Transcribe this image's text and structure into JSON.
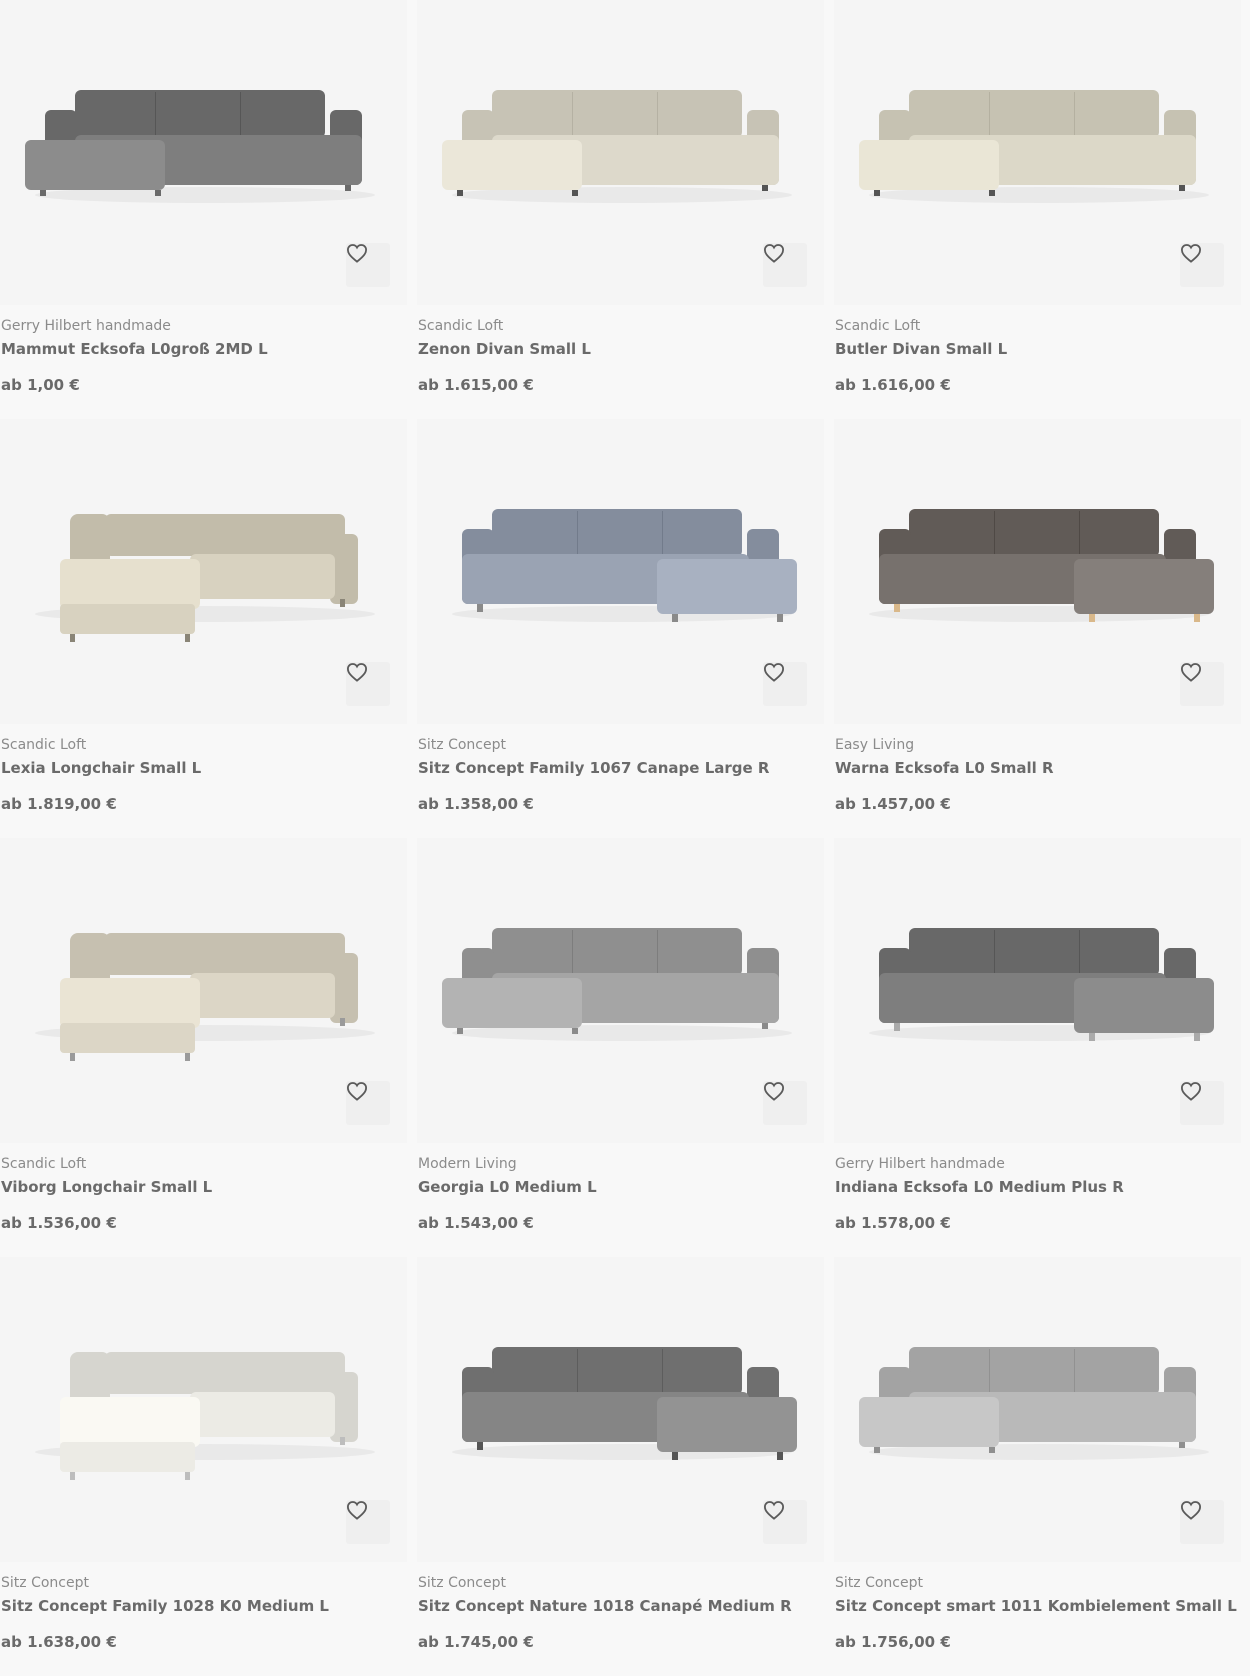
{
  "products": [
    {
      "brand": "Gerry Hilbert handmade",
      "name": "Mammut Ecksofa L0groß 2MD L",
      "price": "ab 1,00 €",
      "color": "#7e7e7e",
      "legs": "#6a6a6a",
      "shape": "chaise-left"
    },
    {
      "brand": "Scandic Loft",
      "name": "Zenon Divan Small L",
      "price": "ab 1.615,00 €",
      "color": "#ddd9cb",
      "legs": "#555555",
      "shape": "chaise-left"
    },
    {
      "brand": "Scandic Loft",
      "name": "Butler Divan Small L",
      "price": "ab 1.616,00 €",
      "color": "#dcd8c8",
      "legs": "#555555",
      "shape": "chaise-left"
    },
    {
      "brand": "Scandic Loft",
      "name": "Lexia Longchair Small L",
      "price": "ab 1.819,00 €",
      "color": "#d8d2c0",
      "legs": "#8a8577",
      "shape": "corner-left"
    },
    {
      "brand": "Sitz Concept",
      "name": "Sitz Concept Family 1067 Canape Large R",
      "price": "ab 1.358,00 €",
      "color": "#9aa3b3",
      "legs": "#8a8a8a",
      "shape": "chaise-right"
    },
    {
      "brand": "Easy Living",
      "name": "Warna Ecksofa L0 Small R",
      "price": "ab 1.457,00 €",
      "color": "#77716d",
      "legs": "#d9b88a",
      "shape": "chaise-right"
    },
    {
      "brand": "Scandic Loft",
      "name": "Viborg Longchair Small L",
      "price": "ab 1.536,00 €",
      "color": "#dcd6c6",
      "legs": "#9a9a9a",
      "shape": "corner-left"
    },
    {
      "brand": "Modern Living",
      "name": "Georgia L0 Medium L",
      "price": "ab 1.543,00 €",
      "color": "#a5a5a5",
      "legs": "#8a8a8a",
      "shape": "chaise-left"
    },
    {
      "brand": "Gerry Hilbert handmade",
      "name": "Indiana Ecksofa L0 Medium Plus R",
      "price": "ab 1.578,00 €",
      "color": "#7e7e7e",
      "legs": "#aaaaaa",
      "shape": "chaise-right"
    },
    {
      "brand": "Sitz Concept",
      "name": "Sitz Concept Family 1028 K0 Medium L",
      "price": "ab 1.638,00 €",
      "color": "#ecebe5",
      "legs": "#bdbdbd",
      "shape": "corner-left"
    },
    {
      "brand": "Sitz Concept",
      "name": "Sitz Concept Nature 1018 Canapé Medium R",
      "price": "ab 1.745,00 €",
      "color": "#858585",
      "legs": "#555555",
      "shape": "chaise-right"
    },
    {
      "brand": "Sitz Concept",
      "name": "Sitz Concept smart 1011 Kombielement Small L",
      "price": "ab 1.756,00 €",
      "color": "#b9b9b9",
      "legs": "#8f8f8f",
      "shape": "chaise-left"
    }
  ],
  "icons": {
    "wishlist": "heart-outline-icon"
  },
  "accent": "#e6454f"
}
